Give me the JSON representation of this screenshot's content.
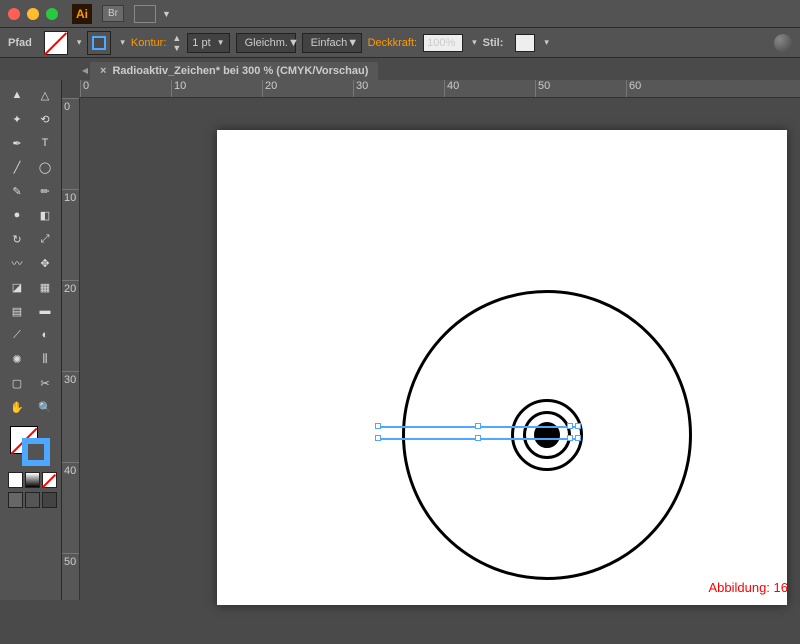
{
  "titlebar": {
    "app": "Ai",
    "bridge": "Br"
  },
  "control": {
    "path": "Pfad",
    "stroke": "Kontur:",
    "weight": "1 pt",
    "cap": "Gleichm.",
    "profile": "Einfach",
    "opacity": "Deckkraft:",
    "opacityVal": "100%",
    "style": "Stil:"
  },
  "tab": {
    "close": "×",
    "name": "Radioaktiv_Zeichen* bei 300 % (CMYK/Vorschau)"
  },
  "rulerH": [
    "0",
    "10",
    "20",
    "30",
    "40",
    "50",
    "60"
  ],
  "rulerV": [
    "0",
    "10",
    "20",
    "30",
    "40",
    "50"
  ],
  "caption": "Abbildung: 16",
  "tools": {
    "sel": "line-tool",
    "items": [
      "selection",
      "direct-select",
      "magic-wand",
      "lasso",
      "pen",
      "type",
      "line",
      "rectangle",
      "brush",
      "pencil",
      "blob",
      "eraser",
      "rotate",
      "scale",
      "width",
      "free-transform",
      "shape-builder",
      "perspective",
      "mesh",
      "gradient",
      "eyedropper",
      "blend",
      "symbol-spray",
      "graph",
      "artboard",
      "slice",
      "hand",
      "zoom"
    ]
  }
}
